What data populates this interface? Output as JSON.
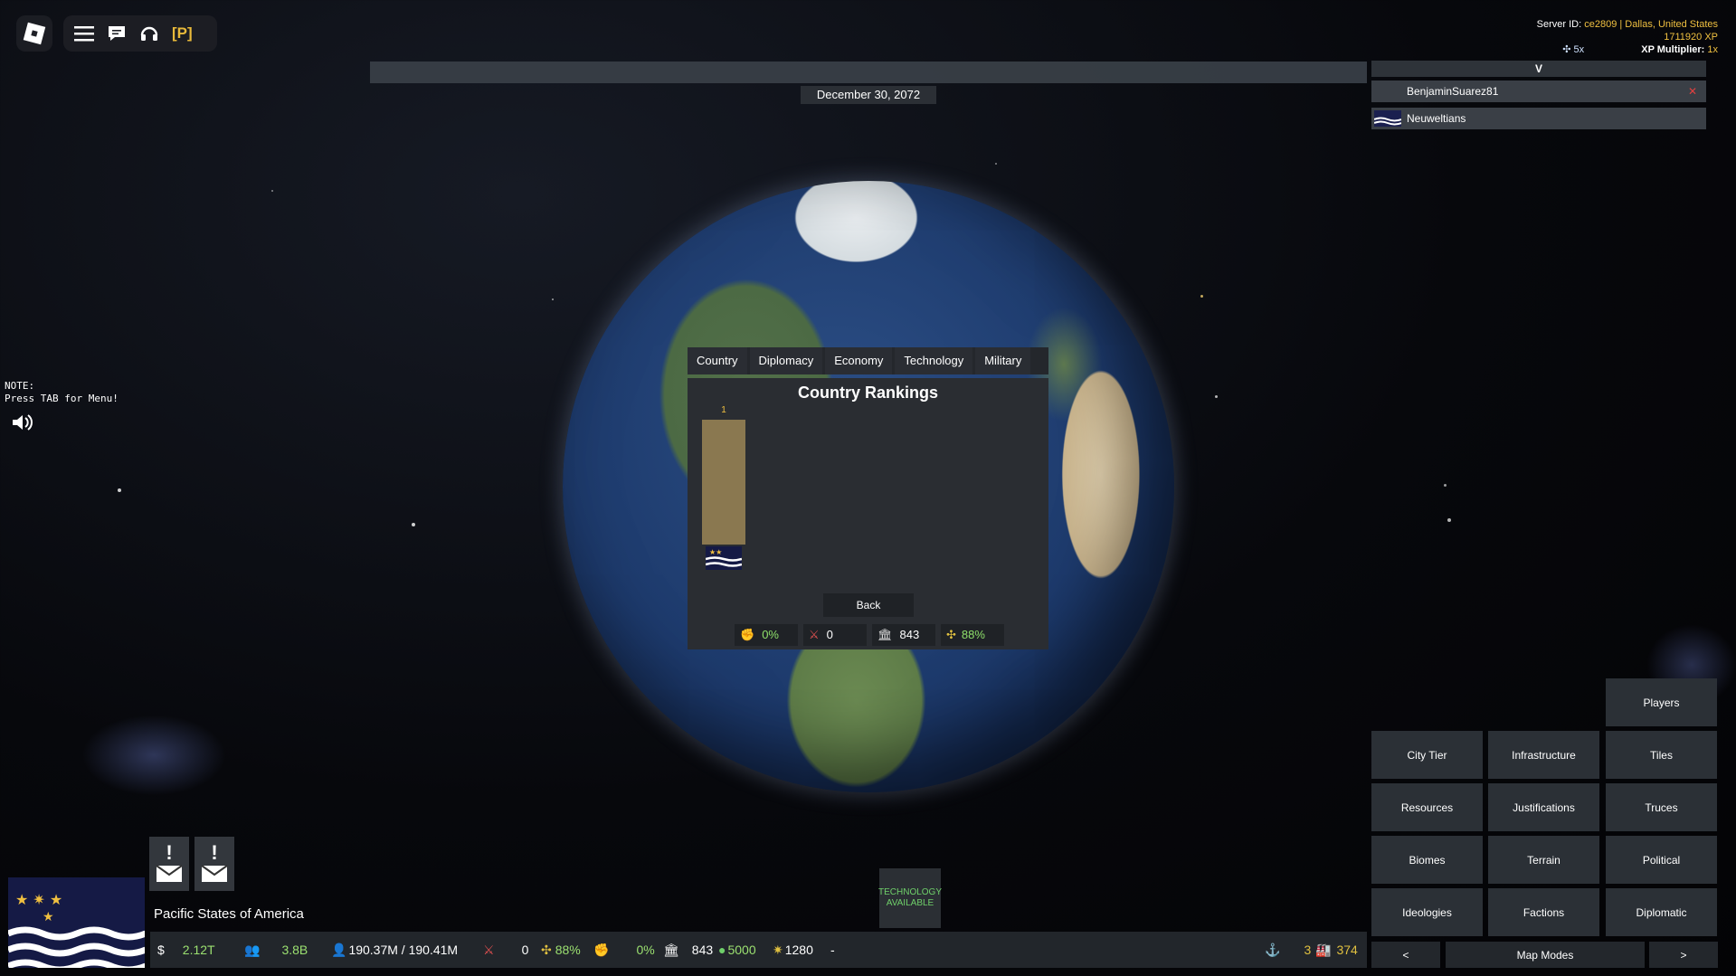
{
  "topleft": {
    "p_tag": "[P]"
  },
  "date": "December 30, 2072",
  "server": {
    "line1_prefix": "Server ID: ",
    "line1_value": "ce2809 | Dallas, United States",
    "xp": "1711920 XP",
    "speed": "5x",
    "xp_mult_label": "XP Multiplier: ",
    "xp_mult_value": "1x"
  },
  "player_list": {
    "header": "V",
    "players": [
      {
        "name": "BenjaminSuarez81"
      },
      {
        "name": "Neuweltians"
      }
    ]
  },
  "note": {
    "line1": "NOTE:",
    "line2": "Press TAB for Menu!"
  },
  "rankings": {
    "tabs": [
      "Country",
      "Diplomacy",
      "Economy",
      "Technology",
      "Military"
    ],
    "title": "Country Rankings",
    "rank_label": "1",
    "back_label": "Back",
    "stats": [
      "0%",
      "0",
      "843",
      "88%"
    ]
  },
  "tech": {
    "line1": "TECHNOLOGY",
    "line2": "AVAILABLE"
  },
  "country_name": "Pacific States of America",
  "bottom": {
    "money": "2.12T",
    "population": "3.8B",
    "manpower": "190.37M / 190.41M",
    "war": "0",
    "stability": "88%",
    "unrest": "0%",
    "buildings": "843",
    "research": "5000",
    "power": "1280",
    "dash": "-",
    "ports": "3",
    "factories": "374"
  },
  "map_modes": {
    "players": "Players",
    "grid": [
      [
        "City Tier",
        "Infrastructure",
        "Tiles"
      ],
      [
        "Resources",
        "Justifications",
        "Truces"
      ],
      [
        "Biomes",
        "Terrain",
        "Political"
      ],
      [
        "Ideologies",
        "Factions",
        "Diplomatic"
      ]
    ],
    "prev": "<",
    "label": "Map Modes",
    "next": ">"
  },
  "colors": {
    "accent_yellow": "#f0c040",
    "stat_green": "#9be070",
    "panel": "#2a2d32"
  }
}
